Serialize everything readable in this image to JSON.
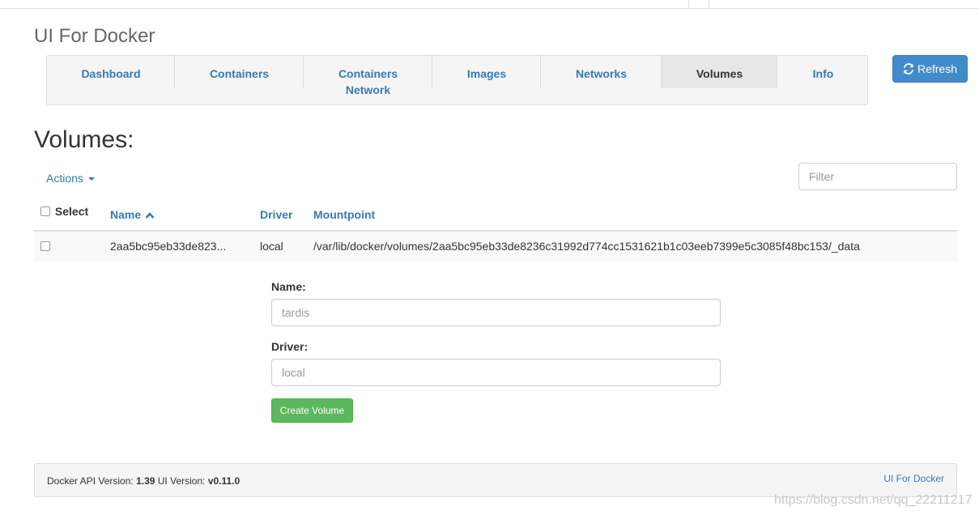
{
  "app": {
    "title": "UI For Docker"
  },
  "nav": {
    "tabs": [
      {
        "label": "Dashboard"
      },
      {
        "label": "Containers"
      },
      {
        "label": "Containers",
        "label2": "Network"
      },
      {
        "label": "Images"
      },
      {
        "label": "Networks"
      },
      {
        "label": "Volumes",
        "active": true
      },
      {
        "label": "Info"
      }
    ],
    "refresh_label": "Refresh"
  },
  "page": {
    "heading": "Volumes:",
    "actions_label": "Actions",
    "filter_placeholder": "Filter"
  },
  "table": {
    "headers": {
      "select": "Select",
      "name": "Name",
      "driver": "Driver",
      "mountpoint": "Mountpoint"
    },
    "rows": [
      {
        "name": "2aa5bc95eb33de823...",
        "driver": "local",
        "mountpoint": "/var/lib/docker/volumes/2aa5bc95eb33de8236c31992d774cc1531621b1c03eeb7399e5c3085f48bc153/_data"
      }
    ]
  },
  "form": {
    "name_label": "Name:",
    "name_placeholder": "tardis",
    "driver_label": "Driver:",
    "driver_placeholder": "local",
    "submit_label": "Create Volume"
  },
  "footer": {
    "api_prefix": "Docker API Version:",
    "api_version": "1.39",
    "ui_prefix": "UI Version:",
    "ui_version": "v0.11.0",
    "link": "UI For Docker"
  },
  "watermark": "https://blog.csdn.net/qq_22211217",
  "colors": {
    "link": "#337ab7",
    "primary": "#428bca",
    "success": "#5cb85c"
  }
}
